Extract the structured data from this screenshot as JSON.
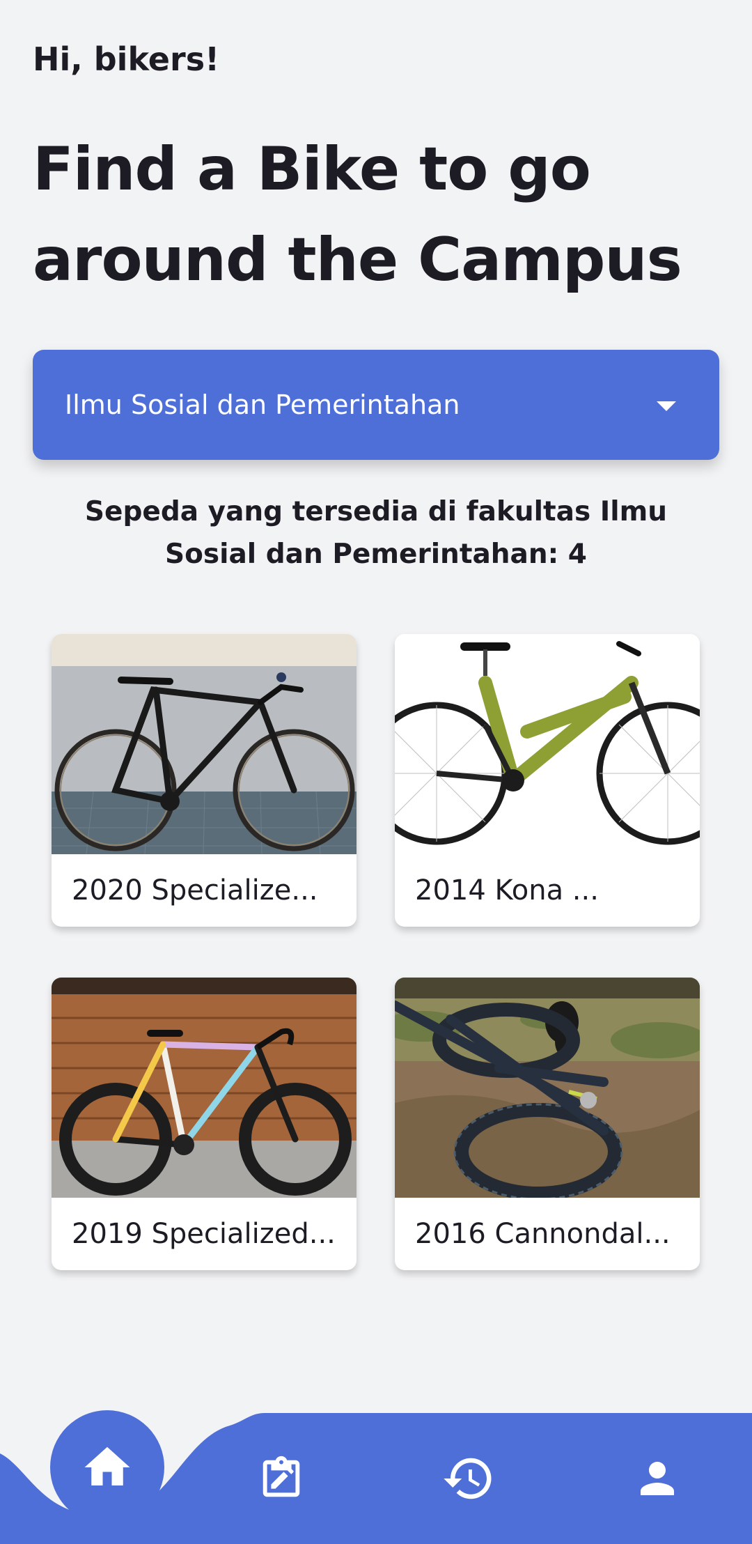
{
  "header": {
    "greeting": "Hi, bikers!",
    "headline": "Find a Bike to go around the Campus"
  },
  "faculty_dropdown": {
    "selected": "Ilmu Sosial dan Pemerintahan"
  },
  "availability": {
    "text": "Sepeda yang tersedia di fakultas Ilmu Sosial dan Pemerintahan: 4"
  },
  "bikes": [
    {
      "name": "2020 Specialize..."
    },
    {
      "name": "2014 Kona ..."
    },
    {
      "name": "2019 Specialized..."
    },
    {
      "name": "2016 Cannondal..."
    }
  ],
  "bottom_nav": {
    "items": [
      {
        "icon": "home-icon",
        "active": true
      },
      {
        "icon": "clipboard-edit-icon",
        "active": false
      },
      {
        "icon": "history-icon",
        "active": false
      },
      {
        "icon": "person-icon",
        "active": false
      }
    ]
  },
  "colors": {
    "background": "#f2f3f5",
    "accent": "#4e6fd8",
    "text": "#1d1b24"
  }
}
